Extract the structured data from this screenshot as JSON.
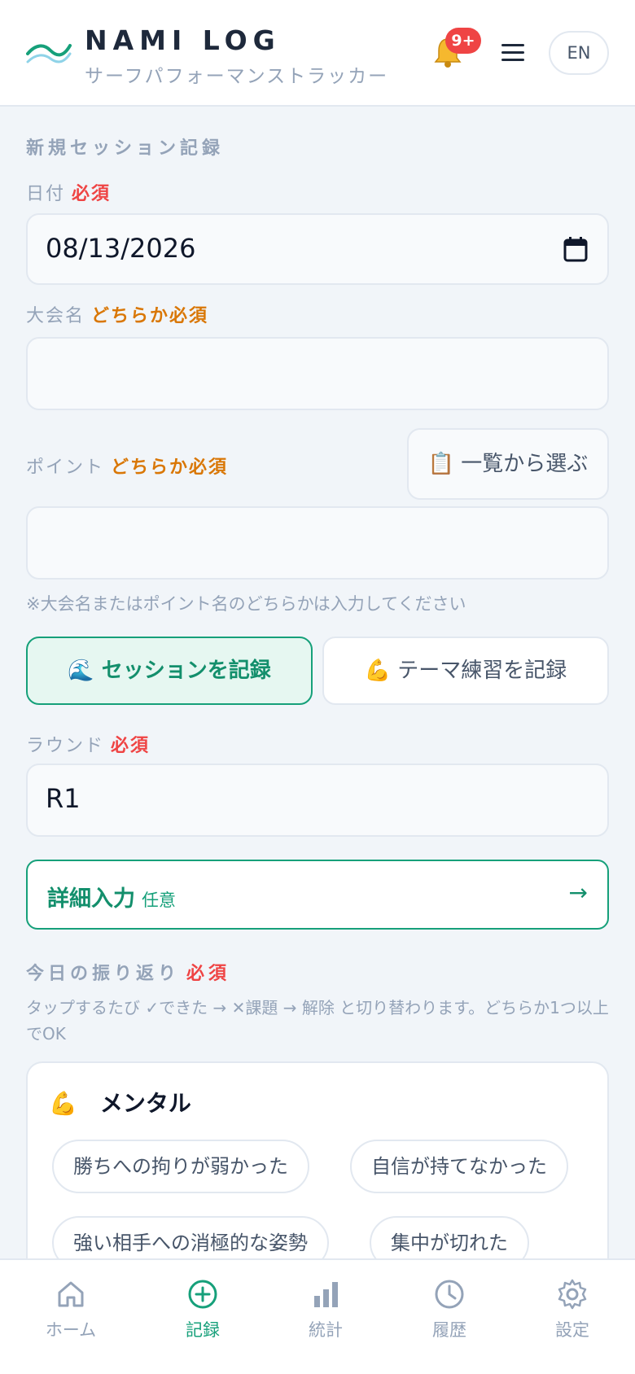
{
  "header": {
    "title": "NAMI LOG",
    "subtitle": "サーフパフォーマンストラッカー",
    "notification_badge": "9+",
    "lang_button": "EN"
  },
  "form": {
    "section_title": "新規セッション記録",
    "date_label": "日付",
    "date_required": "必須",
    "date_value": "08/13/2026",
    "event_label": "大会名",
    "event_required": "どちらか必須",
    "event_value": "",
    "point_label": "ポイント",
    "point_required": "どちらか必須",
    "point_pick_button": "📋 一覧から選ぶ",
    "point_value": "",
    "note": "※大会名またはポイント名のどちらかは入力してください",
    "mode_session": "🌊 セッションを記録",
    "mode_theme": "💪 テーマ練習を記録",
    "round_label": "ラウンド",
    "round_required": "必須",
    "round_value": "R1",
    "detail_title": "詳細入力",
    "detail_optional": "任意",
    "detail_arrow": "→",
    "reflection_title": "今日の振り返り",
    "reflection_required": "必須",
    "reflection_help": "タップするたび ✓できた → ✕課題 → 解除 と切り替わります。どちらか1つ以上でOK"
  },
  "mental_card": {
    "title": "💪　メンタル",
    "chips": [
      "勝ちへの拘りが弱かった",
      "自信が持てなかった",
      "強い相手への消極的な姿勢",
      "集中が切れた"
    ]
  },
  "bottom_nav": {
    "items": [
      {
        "label": "ホーム",
        "icon": "home-icon"
      },
      {
        "label": "記録",
        "icon": "plus-circle-icon"
      },
      {
        "label": "統計",
        "icon": "bar-chart-icon"
      },
      {
        "label": "履歴",
        "icon": "clock-icon"
      },
      {
        "label": "設定",
        "icon": "gear-icon"
      }
    ],
    "active_index": 1
  },
  "colors": {
    "accent": "#16a07a",
    "required": "#ef4444",
    "either_required": "#d97706"
  }
}
